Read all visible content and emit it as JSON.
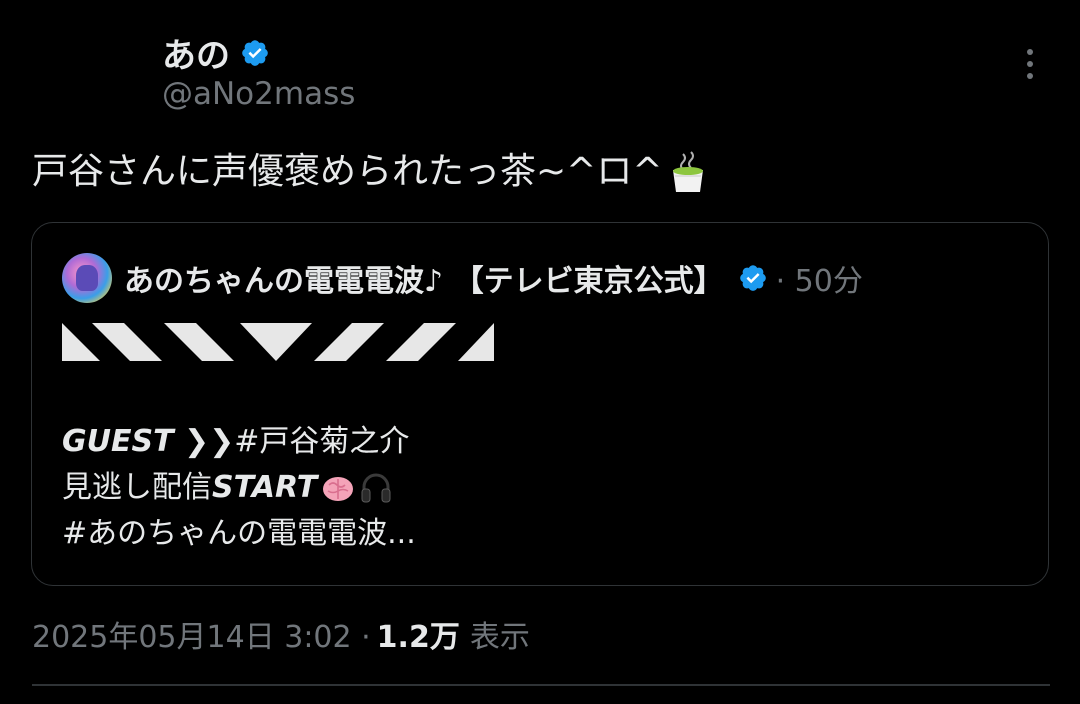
{
  "author": {
    "name": "あの",
    "handle": "@aNo2mass"
  },
  "tweet": {
    "text": "戸谷さんに声優褒められたっ茶~^ロ^"
  },
  "quote": {
    "author_name": "あのちゃんの電電電波♪ 【テレビ東京公式】",
    "time": "· 50分",
    "line1_bold": "GUEST ❯❯",
    "line1_rest": " #戸谷菊之介",
    "line2_prefix": "見逃し配信",
    "line2_bold": "START",
    "line3": "#あのちゃんの電電電波..."
  },
  "meta": {
    "timestamp": "2025年05月14日 3:02 ·",
    "views_count": "1.2万",
    "views_label": "表示"
  },
  "icons": {
    "verified": "verified-badge-icon",
    "more": "more-options-icon",
    "tea": "green-tea-emoji",
    "brain": "brain-emoji",
    "headphones": "headphones-emoji"
  },
  "colors": {
    "background": "#000000",
    "text": "#e7e9ea",
    "secondary": "#71767b",
    "verified": "#1d9bf0",
    "border": "#2f3336"
  }
}
